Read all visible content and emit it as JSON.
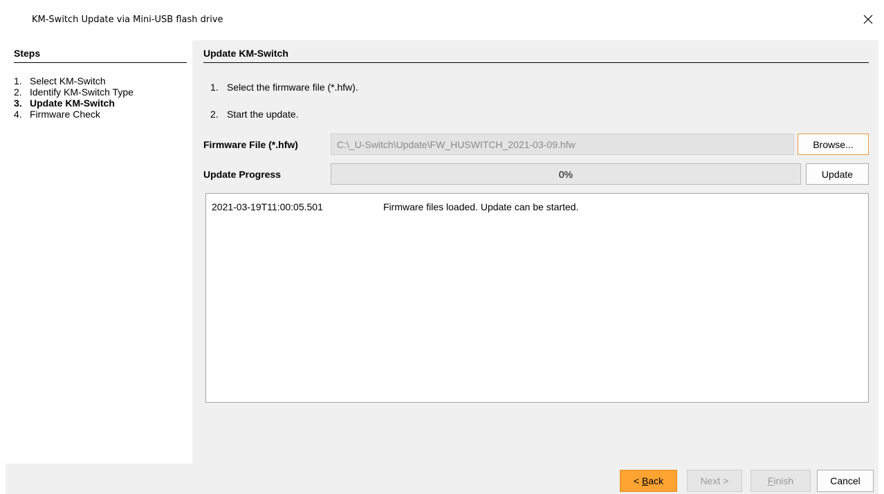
{
  "window": {
    "title": "KM-Switch Update via Mini-USB flash drive",
    "close_icon": "close-icon"
  },
  "steps": {
    "header": "Steps",
    "items": [
      {
        "num": "1.",
        "label": "Select KM-Switch"
      },
      {
        "num": "2.",
        "label": "Identify KM-Switch Type"
      },
      {
        "num": "3.",
        "label": "Update KM-Switch"
      },
      {
        "num": "4.",
        "label": "Firmware Check"
      }
    ],
    "active_index": 2
  },
  "main": {
    "header": "Update KM-Switch",
    "instructions": [
      {
        "num": "1.",
        "text": "Select the firmware file (*.hfw)."
      },
      {
        "num": "2.",
        "text": "Start the update."
      }
    ],
    "firmware_label": "Firmware File (*.hfw)",
    "firmware_value": "C:\\_U-Switch\\Update\\FW_HUSWITCH_2021-03-09.hfw",
    "browse_label": "Browse...",
    "progress_label": "Update Progress",
    "progress_text": "0%",
    "progress_value": 0,
    "update_label": "Update",
    "log": [
      {
        "timestamp": "2021-03-19T11:00:05.501",
        "message": "Firmware files loaded. Update can be started."
      }
    ]
  },
  "footer": {
    "back_prefix": "< ",
    "back_mnemonic": "B",
    "back_rest": "ack",
    "next_label": "Next >",
    "finish_mnemonic": "F",
    "finish_rest": "inish",
    "cancel_label": "Cancel"
  },
  "colors": {
    "accent": "#ffa433",
    "panel_bg": "#f0f0f0",
    "disabled_text": "#9a9a9a"
  }
}
